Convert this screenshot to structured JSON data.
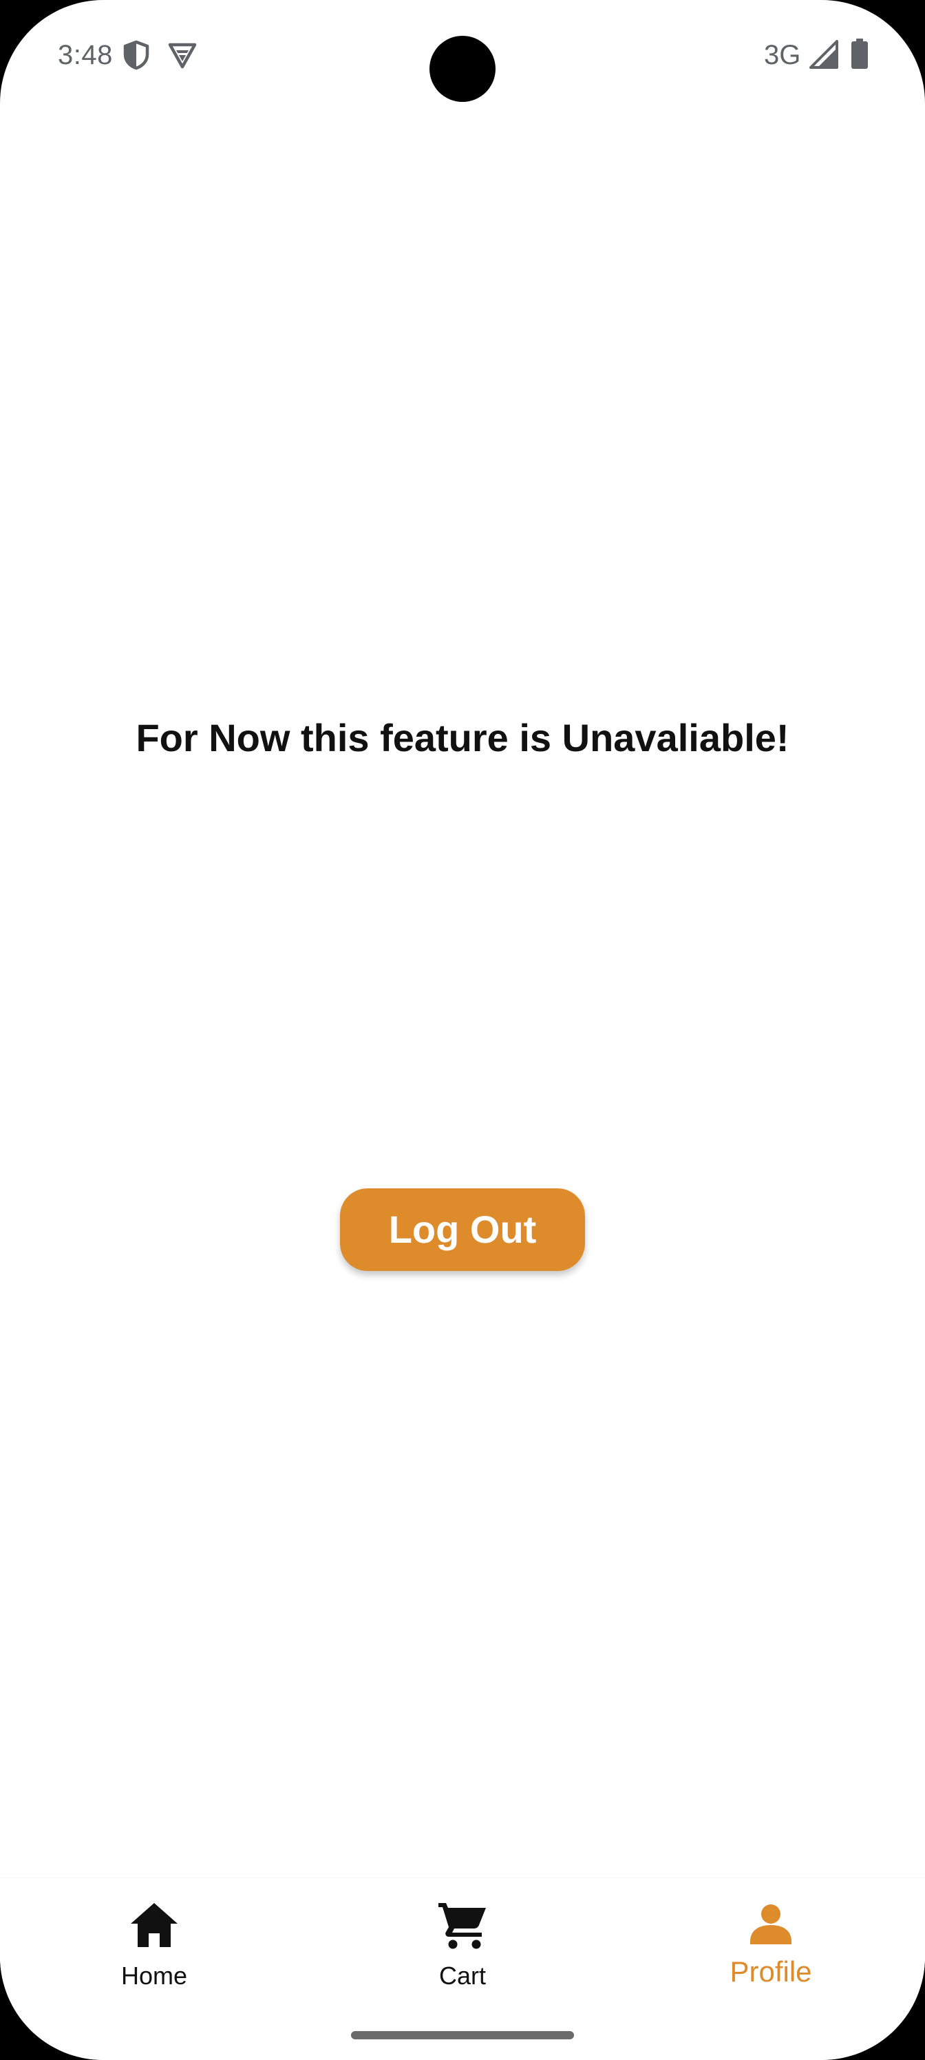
{
  "status_bar": {
    "time": "3:48",
    "network": "3G",
    "icons": [
      "shield-icon",
      "vpn-icon",
      "signal-icon",
      "battery-icon"
    ]
  },
  "main": {
    "message": "For Now this feature is Unavaliable!",
    "logout_label": "Log Out"
  },
  "bottom_nav": {
    "items": [
      {
        "label": "Home",
        "icon": "home-icon",
        "active": false
      },
      {
        "label": "Cart",
        "icon": "cart-icon",
        "active": false
      },
      {
        "label": "Profile",
        "icon": "person-icon",
        "active": true
      }
    ]
  },
  "colors": {
    "accent": "#de8b2c",
    "text": "#111111",
    "status_text": "#5f6368",
    "background": "#ffffff"
  }
}
